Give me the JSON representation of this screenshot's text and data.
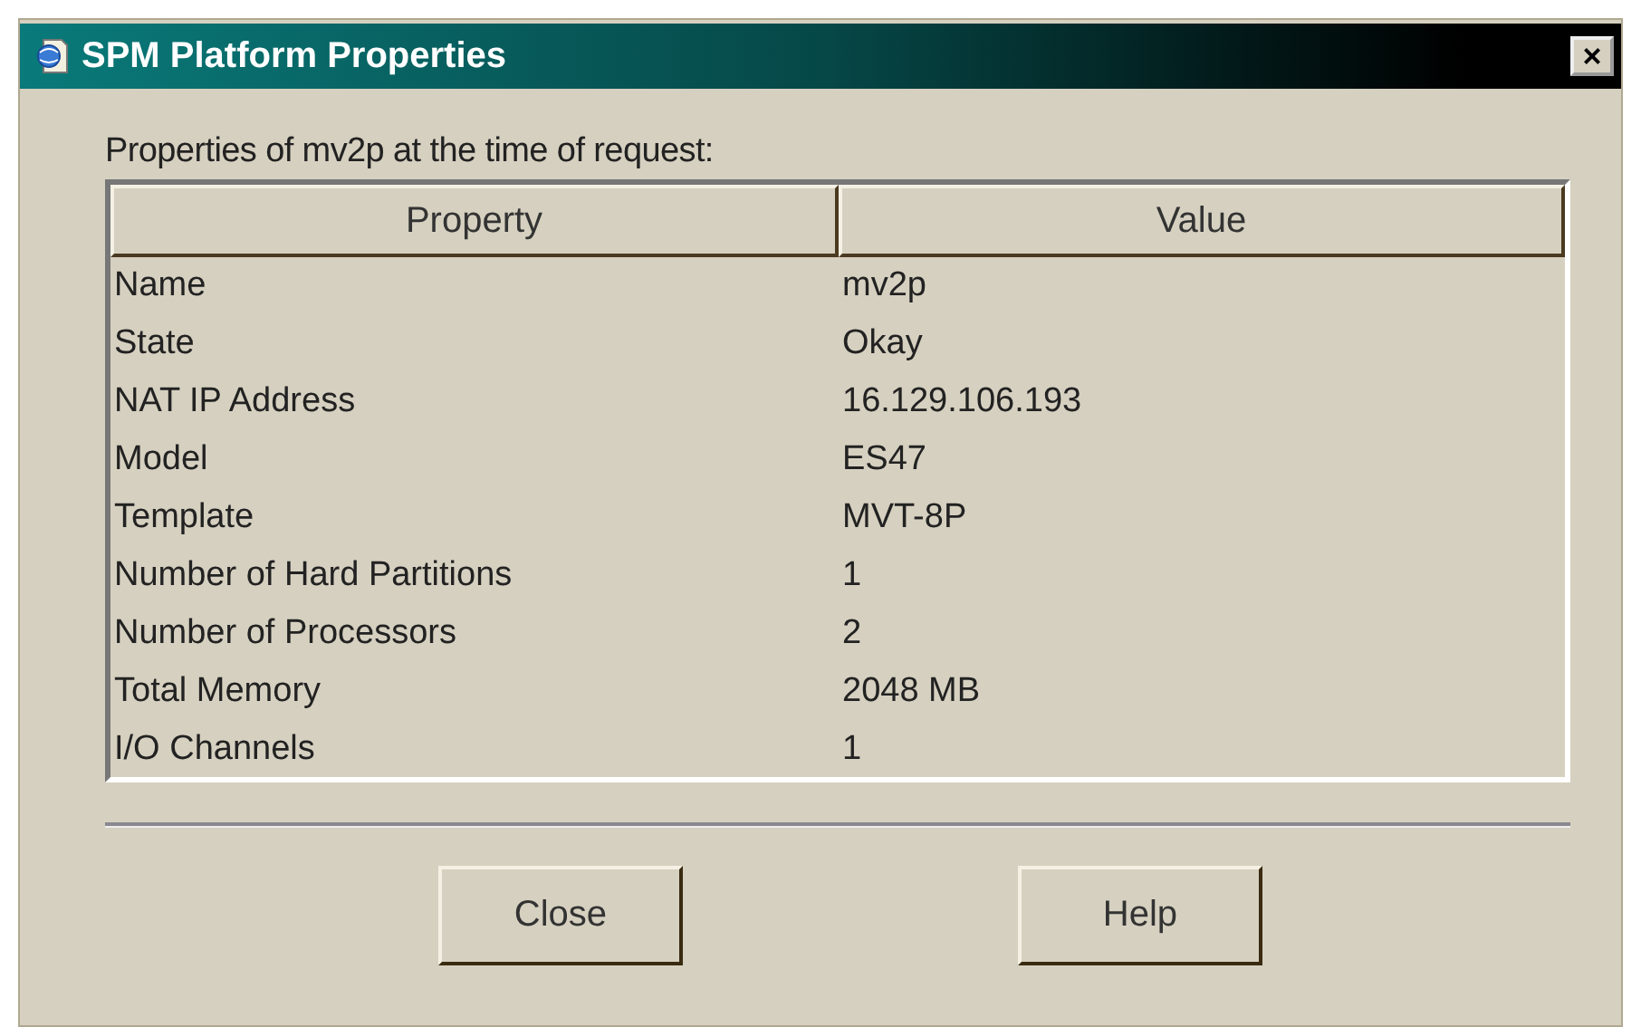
{
  "window": {
    "title": "SPM  Platform Properties",
    "close_label": "×"
  },
  "caption": "Properties of mv2p at the time of request:",
  "table": {
    "columns": [
      "Property",
      "Value"
    ],
    "rows": [
      {
        "property": "Name",
        "value": "mv2p"
      },
      {
        "property": "State",
        "value": "Okay"
      },
      {
        "property": "NAT IP Address",
        "value": "16.129.106.193"
      },
      {
        "property": "Model",
        "value": "ES47"
      },
      {
        "property": "Template",
        "value": "MVT-8P"
      },
      {
        "property": "Number of Hard Partitions",
        "value": "1"
      },
      {
        "property": "Number of Processors",
        "value": "2"
      },
      {
        "property": "Total Memory",
        "value": "2048 MB"
      },
      {
        "property": "I/O Channels",
        "value": "1"
      }
    ]
  },
  "buttons": [
    "Close",
    "Help"
  ]
}
